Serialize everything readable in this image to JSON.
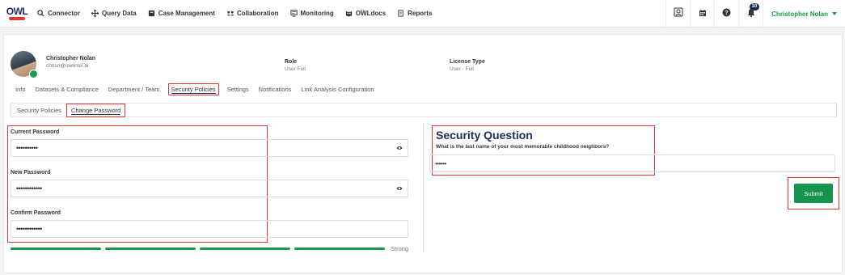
{
  "nav": {
    "logo_text": "OWL",
    "items": [
      {
        "label": "Connector",
        "icon": "search-icon"
      },
      {
        "label": "Query Data",
        "icon": "move-icon"
      },
      {
        "label": "Case Management",
        "icon": "folder-icon"
      },
      {
        "label": "Collaboration",
        "icon": "users-icon"
      },
      {
        "label": "Monitoring",
        "icon": "monitor-icon"
      },
      {
        "label": "OWLdocs",
        "icon": "owl-icon"
      },
      {
        "label": "Reports",
        "icon": "report-icon"
      }
    ],
    "notification_count": "10",
    "user_name": "Christopher Nolan"
  },
  "profile": {
    "name": "Christopher Nolan",
    "email": "chrisn@owlintel.ai",
    "role_label": "Role",
    "role_value": "User Full",
    "license_label": "License Type",
    "license_value": "User - Full"
  },
  "tabs": [
    {
      "label": "Info",
      "active": false
    },
    {
      "label": "Datasets & Compliance",
      "active": false
    },
    {
      "label": "Department / Team",
      "active": false
    },
    {
      "label": "Security Policies",
      "active": true
    },
    {
      "label": "Settings",
      "active": false
    },
    {
      "label": "Notifications",
      "active": false
    },
    {
      "label": "Link Analysis Configuration",
      "active": false
    }
  ],
  "subtabs": [
    {
      "label": "Security Policies",
      "active": false
    },
    {
      "label": "Change Password",
      "active": true
    }
  ],
  "form": {
    "current_label": "Current Password",
    "current_value": "••••••••••",
    "new_label": "New Password",
    "new_value": "••••••••••••",
    "confirm_label": "Confirm Password",
    "confirm_value": "••••••••••••",
    "strength_label": "Strong",
    "strength_level": 1.0
  },
  "security_question": {
    "title": "Security Question",
    "question": "What is the last name of your most memorable childhood neighbors?",
    "answer": "••••••"
  },
  "submit_label": "Submit",
  "colors": {
    "accent_green": "#16934c",
    "brand_navy": "#1e2b59",
    "highlight_red": "#e4342f"
  }
}
